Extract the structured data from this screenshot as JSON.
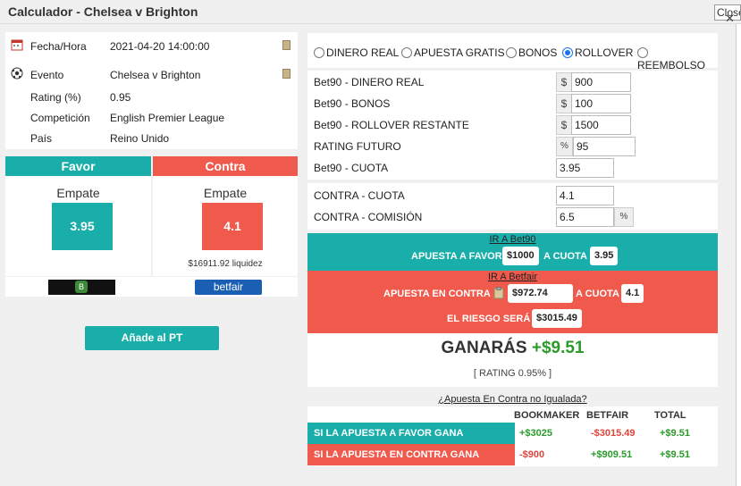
{
  "window": {
    "title": "Calculador - Chelsea v Brighton",
    "close_label": "Close"
  },
  "info": {
    "rows": [
      {
        "label": "Fecha/Hora",
        "value": "2021-04-20 14:00:00"
      },
      {
        "label": "Evento",
        "value": "Chelsea v Brighton"
      },
      {
        "label": "Rating (%)",
        "value": "0.95"
      },
      {
        "label": "Competición",
        "value": "English Premier League"
      },
      {
        "label": "País",
        "value": "Reino Unido"
      }
    ]
  },
  "favor": {
    "header": "Favor",
    "selection": "Empate",
    "odds": "3.95",
    "bookmaker_logo": "bet90-logo"
  },
  "contra": {
    "header": "Contra",
    "selection": "Empate",
    "odds": "4.1",
    "liquidity": "$16911.92 liquidez",
    "exchange_logo": "betfair"
  },
  "add_button": "Añade al PT",
  "modes": {
    "options": [
      "DINERO REAL",
      "APUESTA GRATIS",
      "BONOS",
      "ROLLOVER",
      "REEMBOLSO"
    ],
    "selected": "ROLLOVER"
  },
  "fields": {
    "dinero_real": {
      "label": "Bet90 - DINERO REAL",
      "prefix": "$",
      "value": "900"
    },
    "bonos": {
      "label": "Bet90 - BONOS",
      "prefix": "$",
      "value": "100"
    },
    "rollover": {
      "label": "Bet90 - ROLLOVER RESTANTE",
      "prefix": "$",
      "value": "1500"
    },
    "rating_futuro": {
      "label": "RATING FUTURO",
      "prefix": "%",
      "value": "95"
    },
    "cuota": {
      "label": "Bet90 - CUOTA",
      "value": "3.95"
    },
    "contra_cuota": {
      "label": "CONTRA - CUOTA",
      "value": "4.1"
    },
    "contra_comision": {
      "label": "CONTRA - COMISIÓN",
      "value": "6.5",
      "suffix": "%"
    }
  },
  "bet_favor": {
    "link": "IR A Bet90",
    "label": "APUESTA A FAVOR",
    "amount": "$1000",
    "at_odds_label": "A CUOTA",
    "odds": "3.95"
  },
  "bet_contra": {
    "link": "IR A Betfair",
    "label": "APUESTA EN CONTRA",
    "amount": "$972.74",
    "at_odds_label": "A CUOTA",
    "odds": "4.1",
    "risk_label": "EL RIESGO SERÁ",
    "risk": "$3015.49"
  },
  "result": {
    "label": "GANARÁS",
    "amount": "+$9.51",
    "rating": "[ RATING 0.95% ]"
  },
  "unmatched_link": "¿Apuesta En Contra no Igualada?",
  "table": {
    "headers": [
      "BOOKMAKER",
      "BETFAIR",
      "TOTAL"
    ],
    "rows": [
      {
        "caption": "SI LA APUESTA A FAVOR GANA",
        "bookmaker": "+$3025",
        "betfair": "-$3015.49",
        "total": "+$9.51"
      },
      {
        "caption": "SI LA APUESTA EN CONTRA GANA",
        "bookmaker": "-$900",
        "betfair": "+$909.51",
        "total": "+$9.51"
      }
    ]
  },
  "colors": {
    "teal": "#1aaeaa",
    "red": "#ef5a4c",
    "green_text": "#2a9a2a",
    "red_text": "#e0443a"
  }
}
